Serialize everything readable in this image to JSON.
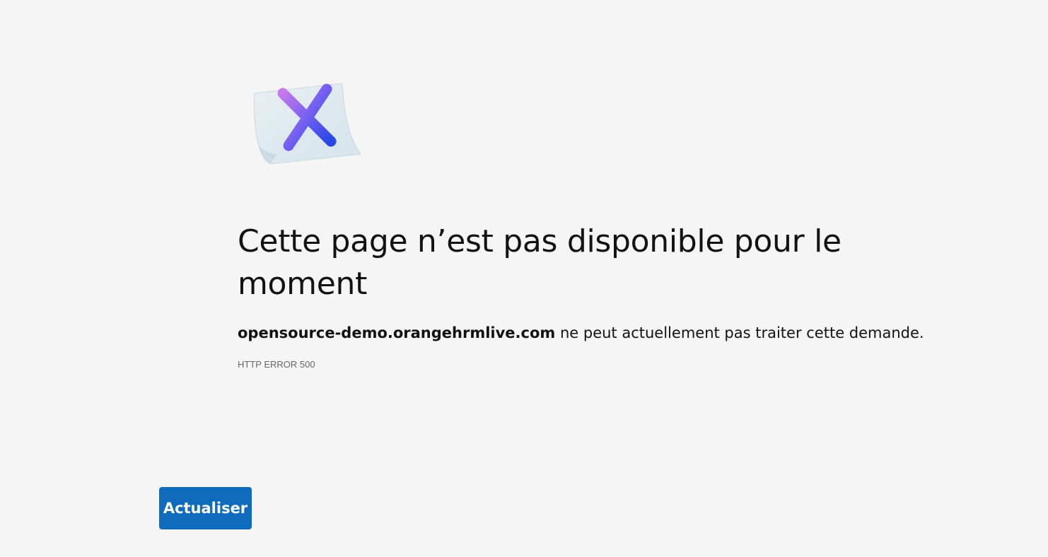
{
  "error": {
    "title": "Cette page n’est pas disponible pour le moment",
    "host": "opensource-demo.orangehrmlive.com",
    "message": " ne peut actuellement pas traiter cette demande.",
    "code": "HTTP ERROR 500"
  },
  "actions": {
    "refresh_label": "Actualiser"
  },
  "illustration": {
    "icon": "error-document-x-icon",
    "colors": {
      "paper": "#dfe9ef",
      "x_top": "#b46ee8",
      "x_bottom": "#2f4fe6"
    }
  },
  "colors": {
    "background": "#f5f5f5",
    "button": "#0f6cbd"
  }
}
